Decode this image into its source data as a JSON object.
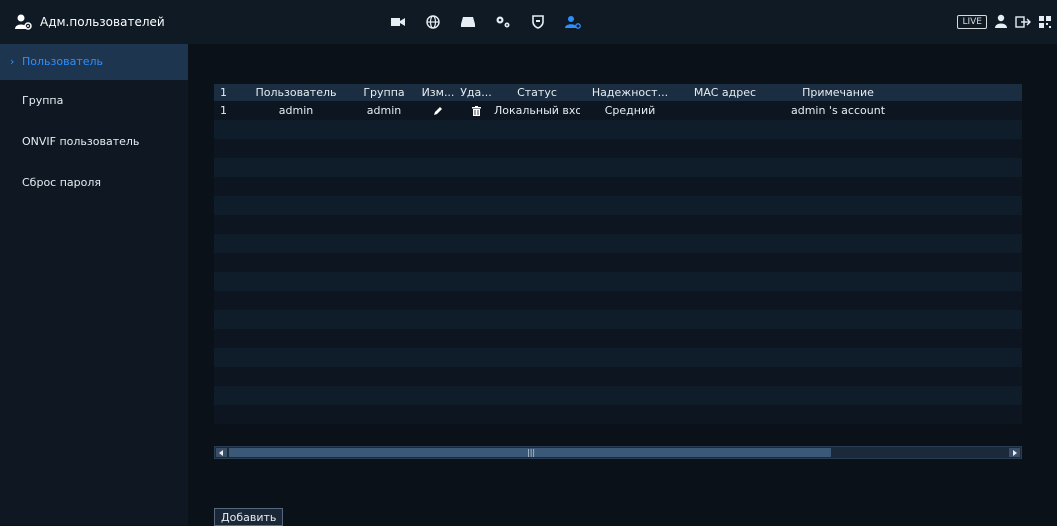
{
  "header": {
    "title": "Адм.пользователей",
    "title_icon": "user-gear-icon",
    "nav_icons": [
      "camera-icon",
      "globe-icon",
      "storage-icon",
      "gears-icon",
      "shield-icon",
      "user-settings-icon"
    ],
    "live_label": "LIVE"
  },
  "sidebar": {
    "items": [
      {
        "label": "Пользователь",
        "active": true
      },
      {
        "label": "Группа",
        "active": false
      },
      {
        "label": "ONVIF пользователь",
        "active": false
      },
      {
        "label": "Сброс пароля",
        "active": false
      }
    ]
  },
  "table": {
    "columns": [
      "1",
      "Пользователь",
      "Группа",
      "Изм...",
      "Уда...",
      "Статус",
      "Надежност...",
      "MAC адрес",
      "Примечание"
    ],
    "rows": [
      {
        "index": "1",
        "user": "admin",
        "group": "admin",
        "edit_icon": "pencil-icon",
        "delete_icon": "trash-icon",
        "status": "Локальный вход",
        "strength": "Средний",
        "mac": "",
        "note": "admin 's account"
      }
    ]
  },
  "actions": {
    "add_label": "Добавить"
  },
  "colors": {
    "accent": "#2d8fff",
    "background": "#0a1119",
    "sidebar_active": "#1e3550"
  }
}
